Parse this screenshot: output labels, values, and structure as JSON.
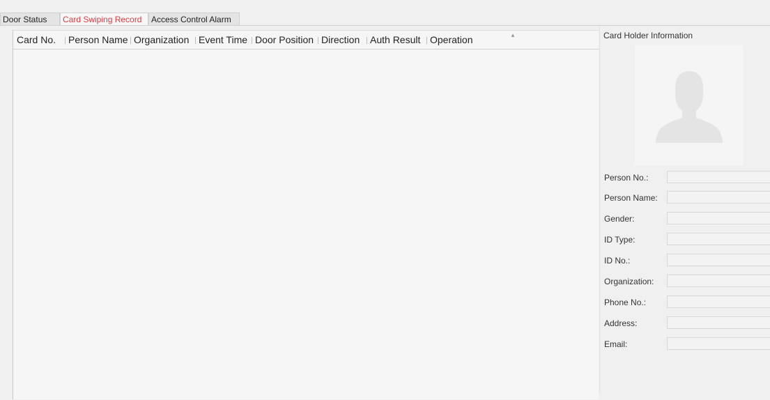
{
  "tabs": [
    {
      "label": "Door Status",
      "active": false
    },
    {
      "label": "Card Swiping Record",
      "active": true
    },
    {
      "label": "Access Control Alarm",
      "active": false
    }
  ],
  "table": {
    "columns": [
      "Card No.",
      "Person Name",
      "Organization",
      "Event Time",
      "Door Position",
      "Direction",
      "Auth Result",
      "Operation"
    ],
    "rows": []
  },
  "card_holder": {
    "title": "Card Holder Information",
    "photo_icon": "person-silhouette-icon",
    "fields": [
      {
        "label": "Person No.:",
        "value": ""
      },
      {
        "label": "Person Name:",
        "value": ""
      },
      {
        "label": "Gender:",
        "value": ""
      },
      {
        "label": "ID Type:",
        "value": ""
      },
      {
        "label": "ID No.:",
        "value": ""
      },
      {
        "label": "Organization:",
        "value": ""
      },
      {
        "label": "Phone No.:",
        "value": ""
      },
      {
        "label": "Address:",
        "value": ""
      },
      {
        "label": "Email:",
        "value": ""
      }
    ]
  },
  "colors": {
    "active_tab_text": "#e0393e",
    "panel_bg": "#f0f0f0",
    "table_bg": "#f6f6f6"
  }
}
